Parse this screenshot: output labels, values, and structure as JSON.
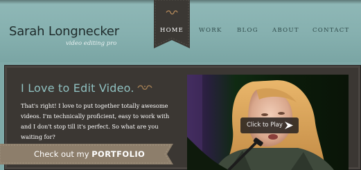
{
  "header": {
    "brand_name": "Sarah Longnecker",
    "brand_tagline": "video editing pro",
    "nav": [
      {
        "label": "HOME",
        "active": true
      },
      {
        "label": "WORK",
        "active": false
      },
      {
        "label": "BLOG",
        "active": false
      },
      {
        "label": "ABOUT",
        "active": false
      },
      {
        "label": "CONTACT",
        "active": false
      }
    ]
  },
  "main": {
    "headline": "I Love to Edit Video.",
    "intro": "That's right! I love to put together totally awesome videos. I'm technically proficient, easy to work with and I don't stop till it's perfect. So what are you waiting for?",
    "cta_prefix": "Check out my",
    "cta_emphasis": "PORTFOLIO"
  },
  "video": {
    "play_label": "Click to Play"
  },
  "colors": {
    "header_teal": "#86b0af",
    "nav_active_bg": "#3b3834",
    "headline_teal": "#8fc0c0",
    "content_brown": "#3b3733",
    "ribbon_taupe": "#8d7e6b"
  },
  "icons": [
    "ornament-icon",
    "play-arrow-icon"
  ]
}
